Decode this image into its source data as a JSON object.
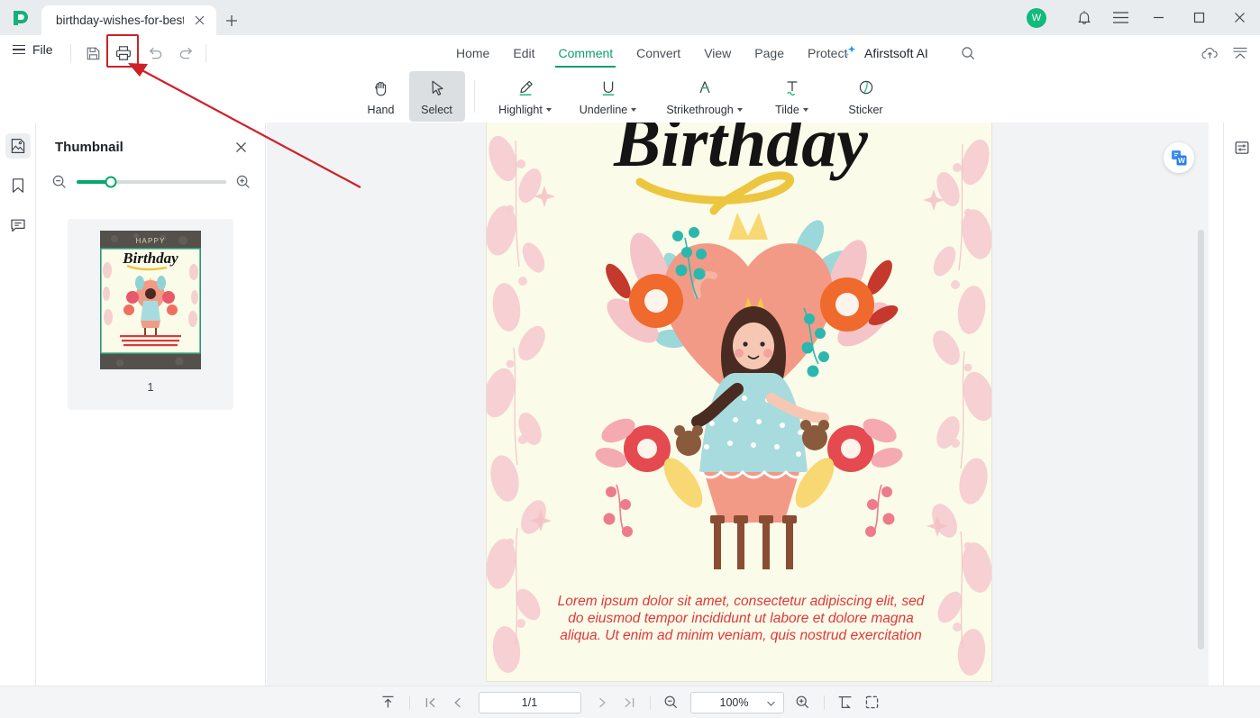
{
  "titlebar": {
    "logo_icon": "afirstsoft-logo-icon",
    "tab_title": "birthday-wishes-for-best...",
    "tab_close_icon": "close-icon",
    "new_tab_icon": "plus-icon",
    "avatar_initial": "W",
    "notification_icon": "bell-icon",
    "menu_icon": "hamburger-menu-icon",
    "minimize_icon": "minimize-icon",
    "maximize_icon": "maximize-icon",
    "close_icon": "close-icon"
  },
  "menubar": {
    "file_label": "File",
    "quick_actions": [
      {
        "name": "save-button",
        "icon": "save-icon"
      },
      {
        "name": "print-button",
        "icon": "printer-icon"
      },
      {
        "name": "undo-button",
        "icon": "undo-icon"
      },
      {
        "name": "redo-button",
        "icon": "redo-icon"
      }
    ],
    "tabs": [
      {
        "label": "Home",
        "active": false
      },
      {
        "label": "Edit",
        "active": false
      },
      {
        "label": "Comment",
        "active": true
      },
      {
        "label": "Convert",
        "active": false
      },
      {
        "label": "View",
        "active": false
      },
      {
        "label": "Page",
        "active": false
      },
      {
        "label": "Protect",
        "active": false
      }
    ],
    "ai_label": "Afirstsoft AI",
    "search_icon": "search-icon",
    "cloud_icon": "cloud-upload-icon",
    "collapse_icon": "collapse-ribbon-icon"
  },
  "toolbar": {
    "tools": [
      {
        "label": "Hand",
        "icon": "hand-icon",
        "selected": false,
        "dropdown": false
      },
      {
        "label": "Select",
        "icon": "cursor-arrow-icon",
        "selected": true,
        "dropdown": false
      },
      {
        "label": "Highlight",
        "icon": "highlighter-icon",
        "selected": false,
        "dropdown": true
      },
      {
        "label": "Underline",
        "icon": "underline-icon",
        "selected": false,
        "dropdown": true
      },
      {
        "label": "Strikethrough",
        "icon": "strikethrough-icon",
        "selected": false,
        "dropdown": true
      },
      {
        "label": "Tilde",
        "icon": "tilde-icon",
        "selected": false,
        "dropdown": true
      },
      {
        "label": "Sticker",
        "icon": "sticker-icon",
        "selected": false,
        "dropdown": false
      }
    ]
  },
  "left_rail": {
    "items": [
      {
        "name": "sidebar-item-thumbnail",
        "icon": "thumbnail-page-icon",
        "active": true
      },
      {
        "name": "sidebar-item-bookmark",
        "icon": "bookmark-icon",
        "active": false
      },
      {
        "name": "sidebar-item-comment",
        "icon": "comment-icon",
        "active": false
      }
    ]
  },
  "thumbnail_panel": {
    "title": "Thumbnail",
    "close_icon": "close-icon",
    "zoom_out_icon": "zoom-out-icon",
    "zoom_in_icon": "zoom-in-icon",
    "zoom_value_pct": 23,
    "pages": [
      {
        "number": "1",
        "selected": true
      }
    ]
  },
  "document": {
    "heading": "Birthday",
    "heading_thumb_top": "HAPPY",
    "body_lines": [
      "Lorem ipsum dolor sit amet, consectetur adipiscing elit, sed",
      "do eiusmod tempor incididunt ut labore et dolore magna",
      "aliqua. Ut enim ad minim veniam, quis nostrud exercitation"
    ],
    "convert_button_icon": "convert-to-word-icon"
  },
  "right_rail": {
    "items": [
      {
        "name": "properties-panel-button",
        "icon": "sliders-icon"
      }
    ]
  },
  "statusbar": {
    "scroll_top_icon": "scroll-to-top-icon",
    "first_page_icon": "first-page-icon",
    "prev_page_icon": "previous-page-icon",
    "page_value": "1/1",
    "next_page_icon": "next-page-icon",
    "last_page_icon": "last-page-icon",
    "zoom_out_icon": "zoom-out-icon",
    "zoom_value": "100%",
    "zoom_dropdown_icon": "chevron-down-icon",
    "zoom_in_icon": "zoom-in-icon",
    "fit_page_icon": "fit-page-icon",
    "fullscreen_icon": "fullscreen-icon"
  },
  "annotation": {
    "highlight_target": "print-button",
    "accent_color": "#cf2027"
  },
  "colors": {
    "titlebar_bg": "#e8ecee",
    "ribbon_bg": "#ffffff",
    "accent_green": "#0f9d6e",
    "viewer_bg": "#f2f3f5",
    "page_bg": "#fbfbe9",
    "statusbar_bg": "#f4f5f6",
    "body_text_red": "#e0383a",
    "avatar_green": "#14b97d"
  }
}
